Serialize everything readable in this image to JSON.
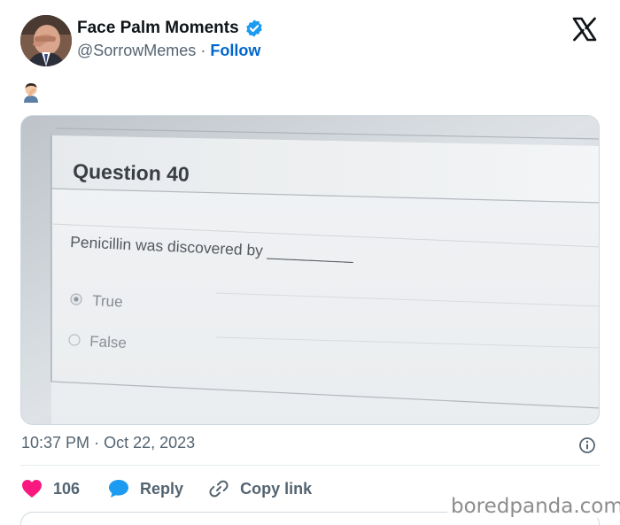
{
  "post": {
    "author_name": "Face Palm Moments",
    "handle": "@SorrowMemes",
    "separator": "·",
    "follow_label": "Follow",
    "verified": true,
    "platform_icon": "x-logo-icon",
    "text_emoji_icon": "facepalm-emoji-icon"
  },
  "photo": {
    "question_title": "Question 40",
    "question_text": "Penicillin was discovered by __________",
    "options": [
      {
        "label": "True",
        "selected": true
      },
      {
        "label": "False",
        "selected": false
      }
    ]
  },
  "meta": {
    "time": "10:37 PM",
    "separator": "·",
    "date": "Oct 22, 2023"
  },
  "actions": {
    "like_count": "106",
    "reply_label": "Reply",
    "copy_label": "Copy link"
  },
  "watermark": "boredpanda.com",
  "colors": {
    "accent_blue": "#0066cc",
    "verified_blue": "#1d9bf0",
    "like_pink": "#f91880",
    "muted_text": "#536471"
  }
}
